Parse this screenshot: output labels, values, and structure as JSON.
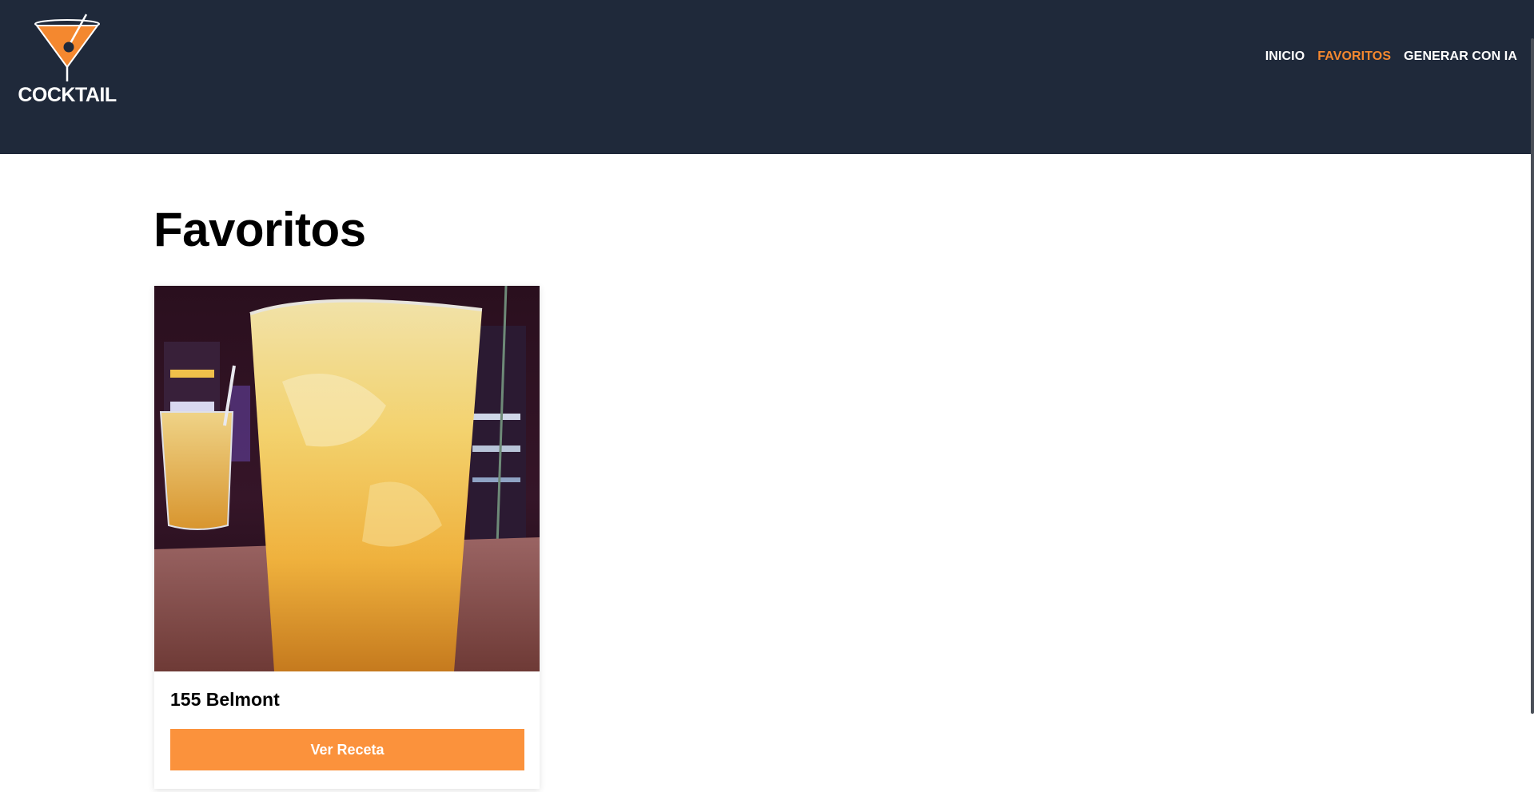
{
  "brand": {
    "name": "COCKTAIL",
    "logo_icon": "cocktail-glass-icon"
  },
  "nav": {
    "items": [
      {
        "label": "INICIO",
        "active": false
      },
      {
        "label": "FAVORITOS",
        "active": true
      },
      {
        "label": "GENERAR CON IA",
        "active": false
      }
    ]
  },
  "page": {
    "title": "Favoritos"
  },
  "favorites": [
    {
      "name": "155 Belmont",
      "button_label": "Ver Receta"
    }
  ],
  "colors": {
    "header_bg": "#1f293a",
    "accent": "#f4882f",
    "button_bg": "#fb923c"
  }
}
